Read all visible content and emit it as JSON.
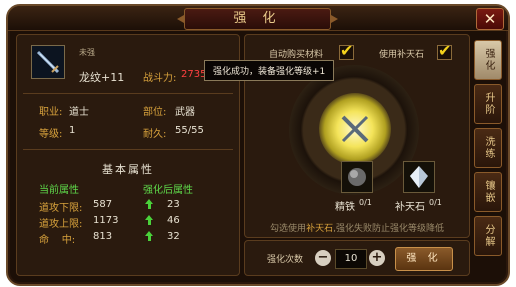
{
  "window": {
    "title": "强 化",
    "close": "✕"
  },
  "item": {
    "state": "未强",
    "name": "龙纹+11",
    "power_label": "战斗力:",
    "power_value": "2735",
    "job_label": "职业:",
    "job_value": "道士",
    "slot_label": "部位:",
    "slot_value": "武器",
    "level_label": "等级:",
    "level_value": "1",
    "durability_label": "耐久:",
    "durability_value": "55/55"
  },
  "attributes": {
    "heading": "基本属性",
    "current_header": "当前属性",
    "after_header": "强化后属性",
    "rows": [
      {
        "name": "道攻下限:",
        "current": "587",
        "after": "23"
      },
      {
        "name": "道攻上限:",
        "current": "1173",
        "after": "46"
      },
      {
        "name": "命    中:",
        "current": "813",
        "after": "32"
      }
    ]
  },
  "options": {
    "auto_buy_label": "自动购买材料",
    "auto_buy_checked": true,
    "use_stone_label": "使用补天石",
    "use_stone_checked": true
  },
  "materials": {
    "iron_label": "精铁",
    "iron_count": "0/1",
    "stone_label": "补天石",
    "stone_count": "0/1"
  },
  "hint": {
    "prefix": "勾选使用",
    "highlight": "补天石",
    "suffix": ",强化失败防止强化等级降低"
  },
  "enhance": {
    "count_label": "强化次数",
    "count_value": "10",
    "minus": "−",
    "plus": "+",
    "button": "强 化"
  },
  "tooltip": "强化成功，装备强化等级+1",
  "tabs": [
    "强化",
    "升阶",
    "洗练",
    "镶嵌",
    "分解"
  ],
  "active_tab": "强化",
  "colors": {
    "gold": "#d8a23c",
    "green": "#5ed84a",
    "red": "#ff4040",
    "check": "#f4d21c"
  }
}
